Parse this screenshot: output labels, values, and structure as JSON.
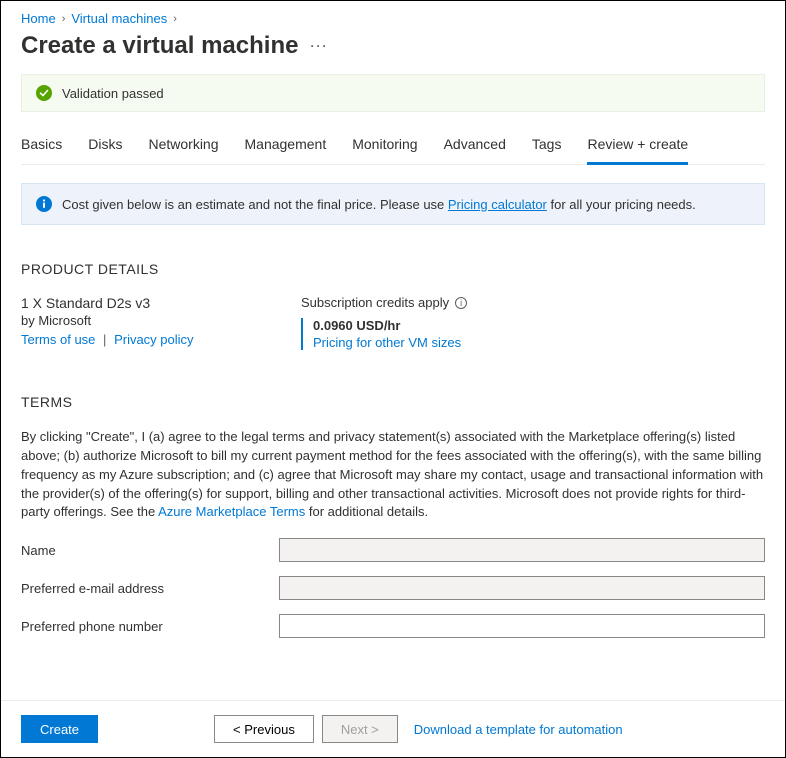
{
  "breadcrumb": {
    "home": "Home",
    "vms": "Virtual machines"
  },
  "page": {
    "title": "Create a virtual machine"
  },
  "validation": {
    "message": "Validation passed"
  },
  "tabs": {
    "basics": "Basics",
    "disks": "Disks",
    "networking": "Networking",
    "management": "Management",
    "monitoring": "Monitoring",
    "advanced": "Advanced",
    "tags": "Tags",
    "review": "Review + create"
  },
  "info": {
    "prefix": "Cost given below is an estimate and not the final price. Please use ",
    "link": "Pricing calculator",
    "suffix": " for all your pricing needs."
  },
  "sections": {
    "product_heading": "PRODUCT DETAILS",
    "terms_heading": "TERMS"
  },
  "product": {
    "name": "1 X Standard D2s v3",
    "by": "by Microsoft",
    "terms_link": "Terms of use",
    "privacy_link": "Privacy policy",
    "credits_label": "Subscription credits apply",
    "price": "0.0960 USD/hr",
    "pricing_link": "Pricing for other VM sizes"
  },
  "terms": {
    "text_before": "By clicking \"Create\", I (a) agree to the legal terms and privacy statement(s) associated with the Marketplace offering(s) listed above; (b) authorize Microsoft to bill my current payment method for the fees associated with the offering(s), with the same billing frequency as my Azure subscription; and (c) agree that Microsoft may share my contact, usage and transactional information with the provider(s) of the offering(s) for support, billing and other transactional activities. Microsoft does not provide rights for third-party offerings. See the ",
    "link": "Azure Marketplace Terms",
    "text_after": " for additional details."
  },
  "form": {
    "name_label": "Name",
    "email_label": "Preferred e-mail address",
    "phone_label": "Preferred phone number",
    "name_value": "",
    "email_value": "",
    "phone_value": ""
  },
  "footer": {
    "create": "Create",
    "previous": "< Previous",
    "next": "Next >",
    "download": "Download a template for automation"
  }
}
